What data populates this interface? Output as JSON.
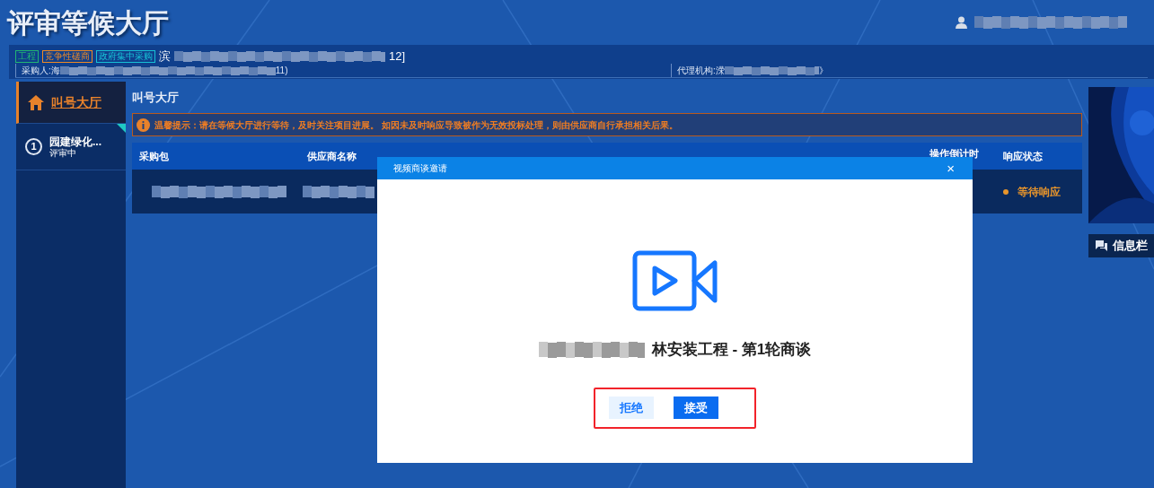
{
  "page_title": "评审等候大厅",
  "project": {
    "tags": [
      {
        "label": "工程",
        "color": "#22b573"
      },
      {
        "label": "竞争性磋商",
        "color": "#f08a24"
      },
      {
        "label": "政府集中采购",
        "color": "#17c1d6"
      }
    ],
    "name_start": "滨",
    "name_end": "12]",
    "buyer_label": "采购人:",
    "buyer_start": "海",
    "buyer_end": "11)",
    "agency_label": "代理机构:",
    "agency_start": "溁",
    "agency_end": "》"
  },
  "sidebar": {
    "items": [
      {
        "kind": "home",
        "label": "叫号大厅",
        "selected": true
      },
      {
        "kind": "package",
        "number": "1",
        "label": "园建绿化...",
        "status": "评审中",
        "selected": false
      }
    ]
  },
  "main": {
    "title": "叫号大厅",
    "notice": "温馨提示：请在等候大厅进行等待，及时关注项目进展。 如因未及时响应导致被作为无效投标处理，则由供应商自行承担相关后果。",
    "table": {
      "columns": [
        "采购包",
        "供应商名称",
        "操作倒计时",
        "响应状态"
      ],
      "rows": [
        {
          "status": "等待响应",
          "color": "#e8952b"
        }
      ]
    }
  },
  "right_panel": {
    "info_title": "信息栏"
  },
  "dialog": {
    "title": "视频商谈邀请",
    "close": "×",
    "subject_end": "林安装工程 - 第1轮商谈",
    "buttons": [
      {
        "kind": "secondary",
        "label": "拒绝"
      },
      {
        "kind": "primary",
        "label": "接受"
      }
    ]
  }
}
